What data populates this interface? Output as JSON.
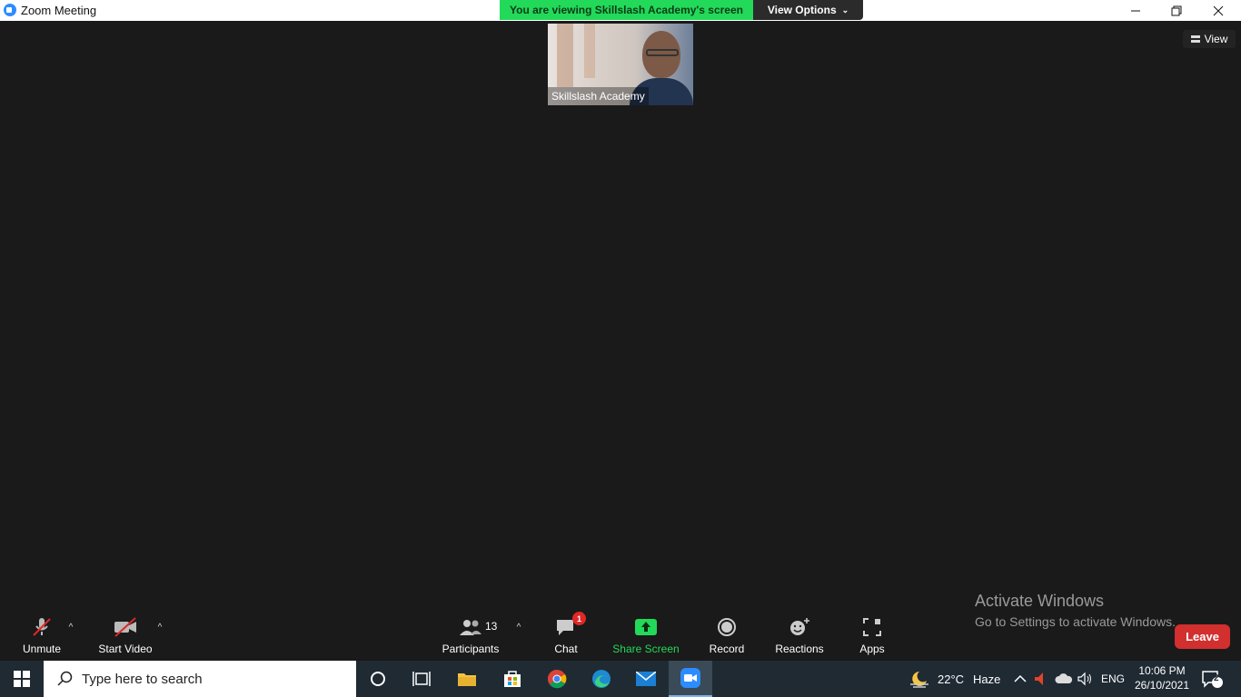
{
  "window": {
    "title": "Zoom Meeting"
  },
  "banner": {
    "viewing_text": "You are viewing Skillslash Academy's screen",
    "view_options_label": "View Options"
  },
  "video_tile": {
    "participant_name": "Skillslash Academy"
  },
  "view_button": {
    "label": "View"
  },
  "watermark": {
    "line1": "Activate Windows",
    "line2": "Go to Settings to activate Windows."
  },
  "toolbar": {
    "unmute_label": "Unmute",
    "start_video_label": "Start Video",
    "participants_label": "Participants",
    "participants_count": "13",
    "chat_label": "Chat",
    "chat_badge": "1",
    "share_screen_label": "Share Screen",
    "record_label": "Record",
    "reactions_label": "Reactions",
    "apps_label": "Apps",
    "leave_label": "Leave"
  },
  "taskbar": {
    "search_placeholder": "Type here to search",
    "weather_temp": "22°C",
    "weather_desc": "Haze",
    "language": "ENG",
    "time": "10:06 PM",
    "date": "26/10/2021",
    "notification_count": "2"
  },
  "colors": {
    "accent_green": "#23d959",
    "leave_red": "#d22f2f",
    "zoom_blue": "#2d8cff",
    "background": "#1a1a1a"
  }
}
